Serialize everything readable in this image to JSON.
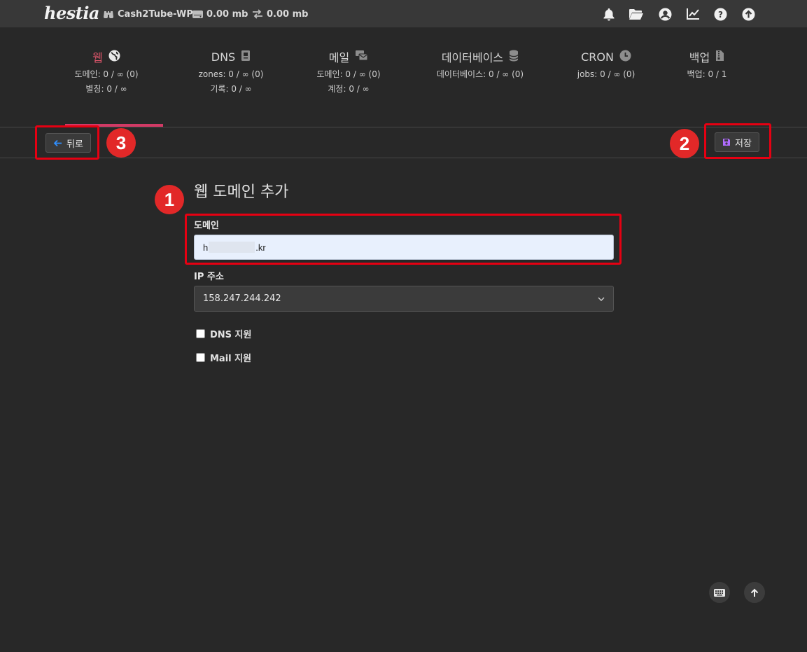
{
  "topbar": {
    "logo": "hestia",
    "user": "Cash2Tube-WP",
    "disk": "0.00 mb",
    "bandwidth": "0.00 mb",
    "icons": [
      "bell-icon",
      "folder-open-icon",
      "user-circle-icon",
      "chart-line-icon",
      "help-circle-icon",
      "update-circle-icon"
    ]
  },
  "tabs": [
    {
      "title": "웹",
      "icon": "globe-icon",
      "lines": [
        "도메인: 0 / ∞ (0)",
        "별칭: 0 / ∞"
      ],
      "active": true
    },
    {
      "title": "DNS",
      "icon": "dns-book-icon",
      "lines": [
        "zones: 0 / ∞ (0)",
        "기록: 0 / ∞"
      ]
    },
    {
      "title": "메일",
      "icon": "mail-stack-icon",
      "lines": [
        "도메인: 0 / ∞ (0)",
        "계정: 0 / ∞"
      ]
    },
    {
      "title": "데이터베이스",
      "icon": "database-icon",
      "lines": [
        "데이터베이스: 0 / ∞ (0)"
      ]
    },
    {
      "title": "CRON",
      "icon": "clock-icon",
      "lines": [
        "jobs: 0 / ∞ (0)"
      ]
    },
    {
      "title": "백업",
      "icon": "file-zip-icon",
      "lines": [
        "백업: 0 / 1"
      ]
    }
  ],
  "toolbar": {
    "back_label": "뒤로",
    "save_label": "저장"
  },
  "annotations": [
    "1",
    "2",
    "3"
  ],
  "form": {
    "title": "웹 도메인 추가",
    "domain_label": "도메인",
    "domain_prefix": "h",
    "domain_suffix": ".kr",
    "ip_label": "IP 주소",
    "ip_value": "158.247.244.242",
    "dns_support_label": "DNS 지원",
    "mail_support_label": "Mail 지원"
  },
  "colors": {
    "accent": "#d13a65",
    "annotation": "#e60012",
    "save_icon": "#b06cff",
    "back_icon": "#2f8fff"
  }
}
